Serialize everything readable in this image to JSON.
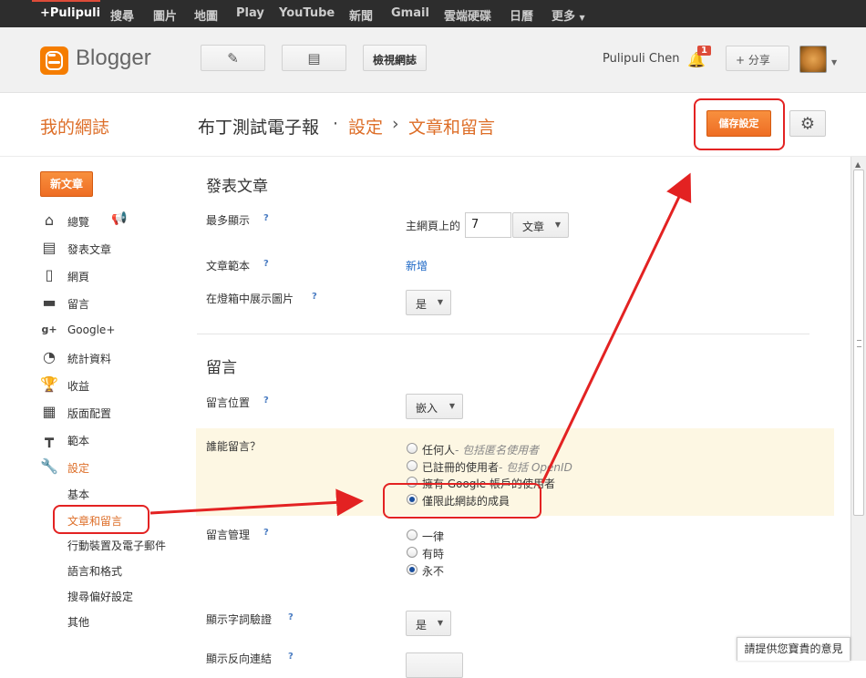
{
  "gbar": {
    "items": [
      "+Pulipuli",
      "搜尋",
      "圖片",
      "地圖",
      "Play",
      "YouTube",
      "新聞",
      "Gmail",
      "雲端硬碟",
      "日曆",
      "更多"
    ]
  },
  "header": {
    "logo_text": "Blogger",
    "view_blog": "檢視網誌",
    "username": "Pulipuli Chen",
    "notifications": "1",
    "share": "分享"
  },
  "titlebar": {
    "my_blogs": "我的網誌",
    "blog_name": "布丁測試電子報",
    "sep1": "·",
    "crumb_settings": "設定",
    "sep2": "›",
    "crumb_page": "文章和留言",
    "save_label": "儲存設定"
  },
  "sidebar": {
    "new_post": "新文章",
    "items": [
      {
        "label": "總覽",
        "icon": "home-icon"
      },
      {
        "label": "發表文章",
        "icon": "posts-icon"
      },
      {
        "label": "網頁",
        "icon": "pages-icon"
      },
      {
        "label": "留言",
        "icon": "comments-icon"
      },
      {
        "label": "Google+",
        "icon": "google-plus-icon"
      },
      {
        "label": "統計資料",
        "icon": "stats-icon"
      },
      {
        "label": "收益",
        "icon": "trophy-icon"
      },
      {
        "label": "版面配置",
        "icon": "layout-icon"
      },
      {
        "label": "範本",
        "icon": "template-icon"
      },
      {
        "label": "設定",
        "icon": "wrench-icon"
      }
    ],
    "sub_items": [
      "基本",
      "文章和留言",
      "行動裝置及電子郵件",
      "語言和格式",
      "搜尋偏好設定",
      "其他"
    ]
  },
  "posts": {
    "title": "發表文章",
    "show_at_most": {
      "label": "最多顯示",
      "prefix": "主網頁上的",
      "value": "7",
      "unit": "文章"
    },
    "template": {
      "label": "文章範本",
      "link": "新增"
    },
    "lightbox": {
      "label": "在燈箱中展示圖片",
      "value": "是"
    }
  },
  "comments": {
    "title": "留言",
    "location": {
      "label": "留言位置",
      "value": "嵌入"
    },
    "who_can": {
      "label": "誰能留言？",
      "options": [
        {
          "text": "任何人",
          "note": "- 包括匿名使用者"
        },
        {
          "text": "已註冊的使用者",
          "note": "- 包括 OpenID"
        },
        {
          "text": "擁有 Google 帳戶的使用者",
          "note": ""
        },
        {
          "text": "僅限此網誌的成員",
          "note": ""
        }
      ],
      "selected": 3
    },
    "moderation": {
      "label": "留言管理",
      "options": [
        "一律",
        "有時",
        "永不"
      ],
      "selected": 2
    },
    "word_verification": {
      "label": "顯示字詞驗證",
      "value": "是"
    },
    "backlinks": {
      "label": "顯示反向連結"
    }
  },
  "feedback": "請提供您寶貴的意見",
  "colors": {
    "accent": "#dd6e28",
    "button": "#f08030",
    "annotation": "#e32222",
    "link": "#1a66c5"
  }
}
